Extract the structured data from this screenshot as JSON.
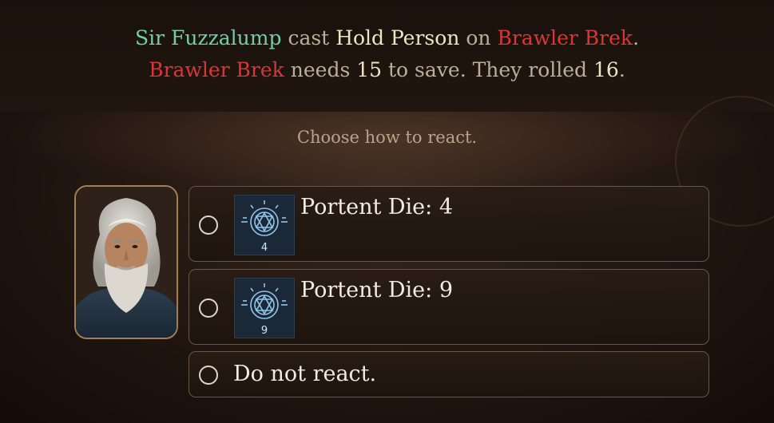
{
  "message": {
    "line1": {
      "caster": "Sir Fuzzalump",
      "verb": "cast",
      "spell": "Hold Person",
      "preposition": "on",
      "target": "Brawler Brek",
      "end": "."
    },
    "line2": {
      "target": "Brawler Brek",
      "needs": "needs",
      "dc": "15",
      "to_save": "to save. They rolled",
      "roll": "16",
      "end": "."
    }
  },
  "prompt": "Choose how to react.",
  "options": [
    {
      "label": "Portent Die: 4",
      "icon": "portent-die-icon",
      "die_value": "4"
    },
    {
      "label": "Portent Die: 9",
      "icon": "portent-die-icon",
      "die_value": "9"
    },
    {
      "label": "Do not react."
    }
  ],
  "colors": {
    "caster": "#6fd1a3",
    "target": "#d9363a",
    "highlight": "#efe3c4",
    "icon_glow": "#8fc6e8"
  }
}
